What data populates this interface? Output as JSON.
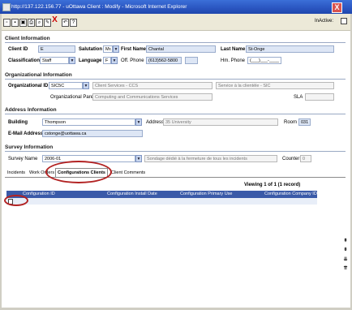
{
  "window": {
    "title": "http://137.122.156.77 - uOttawa Client : Modify - Microsoft Internet Explorer",
    "close_glyph": "X"
  },
  "toolbar": {
    "icons": [
      "close-window-icon",
      "save-icon",
      "save-close-icon",
      "print-icon",
      "search-icon",
      "edit-icon",
      "delete-icon",
      "undo-icon",
      "help-icon"
    ],
    "glyphs": [
      "▫",
      "▪",
      "▣",
      "⎙",
      "⌕",
      "✎",
      "X",
      "↶",
      "?"
    ],
    "inactive_label": "InActive:"
  },
  "client_info": {
    "header": "Client Information",
    "client_id_label": "Client ID",
    "client_id_value": "E",
    "salutation_label": "Salutation",
    "salutation_value": "Mr.",
    "first_name_label": "First Name",
    "first_name_value": "Chantal",
    "last_name_label": "Last Name",
    "last_name_value": "St-Onge",
    "classification_label": "Classification",
    "classification_value": "Staff",
    "language_label": "Language",
    "language_value": "F",
    "off_phone_label": "Off. Phone",
    "off_phone_value": "(613)562-5800",
    "hm_phone_label": "Hm. Phone",
    "hm_phone_value": "(___)___-____"
  },
  "org_info": {
    "header": "Organizational Information",
    "org_id_label": "Organizational ID",
    "org_id_value": "SIC5C",
    "org_name_en": "Client Services - CCS",
    "org_name_fr": "Service à la clientèle - SIC",
    "org_parent_label": "Organizational Parent",
    "org_parent_value": "Computing and Communications Services",
    "sla_label": "SLA"
  },
  "address_info": {
    "header": "Address Information",
    "building_label": "Building",
    "building_value": "Thompson",
    "address_label": "Address",
    "address_value": "35 University",
    "room_label": "Room",
    "room_value": "031",
    "email_label": "E-Mail Address",
    "email_value": "cstonge@uottawa.ca"
  },
  "survey_info": {
    "header": "Survey Information",
    "survey_name_label": "Survey Name",
    "survey_name_value": "2006-01",
    "survey_desc": "Sondage dédié à la fermeture de tous les incidents",
    "counter_label": "Counter",
    "counter_value": "0"
  },
  "tabs": [
    "Incidents",
    "Work Orders",
    "Configurations Clients",
    "Client Comments"
  ],
  "grid": {
    "viewing": "Viewing 1 of 1 (1 record)",
    "columns": [
      "Configuration ID",
      "Configuration Install Date",
      "Configuration Primary Use",
      "Configuration Company ID"
    ]
  },
  "side_nav_glyphs": [
    "⇞",
    "⇟",
    "⇊",
    "⇈"
  ],
  "colors": {
    "title_bar": "#2a55c0",
    "grid_header": "#3a5aa8",
    "highlight_circle": "#b22222",
    "field_bg": "#dde6f5"
  }
}
